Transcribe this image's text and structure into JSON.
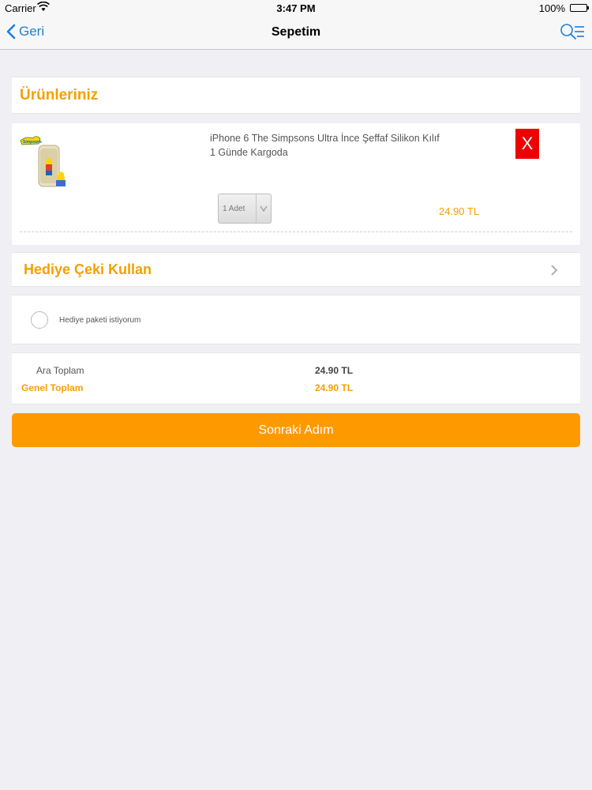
{
  "status_bar": {
    "carrier": "Carrier",
    "time": "3:47 PM",
    "battery": "100%"
  },
  "nav": {
    "back_label": "Geri",
    "title": "Sepetim",
    "search_icon": "search-list-icon"
  },
  "cart": {
    "header": "Ürünleriniz",
    "items": [
      {
        "name": "iPhone 6 The Simpsons Ultra İnce Şeffaf Silikon Kılıf",
        "shipping": "1 Günde Kargoda",
        "remove_label": "X",
        "quantity": "1 Adet",
        "price": "24.90 TL",
        "thumb_logo": "Simpsons"
      }
    ]
  },
  "gift_card": {
    "label": "Hediye Çeki Kullan"
  },
  "gift_pack": {
    "label": "Hediye paketi istiyorum",
    "checked": false
  },
  "totals": {
    "subtotal_label": "Ara Toplam",
    "subtotal_value": "24.90 TL",
    "total_label": "Genel Toplam",
    "total_value": "24.90 TL"
  },
  "next_button": "Sonraki Adım",
  "colors": {
    "accent": "#f5a000",
    "button": "#ff9900",
    "remove": "#ee0000",
    "link": "#1e7fd8",
    "background": "#efeff4"
  }
}
